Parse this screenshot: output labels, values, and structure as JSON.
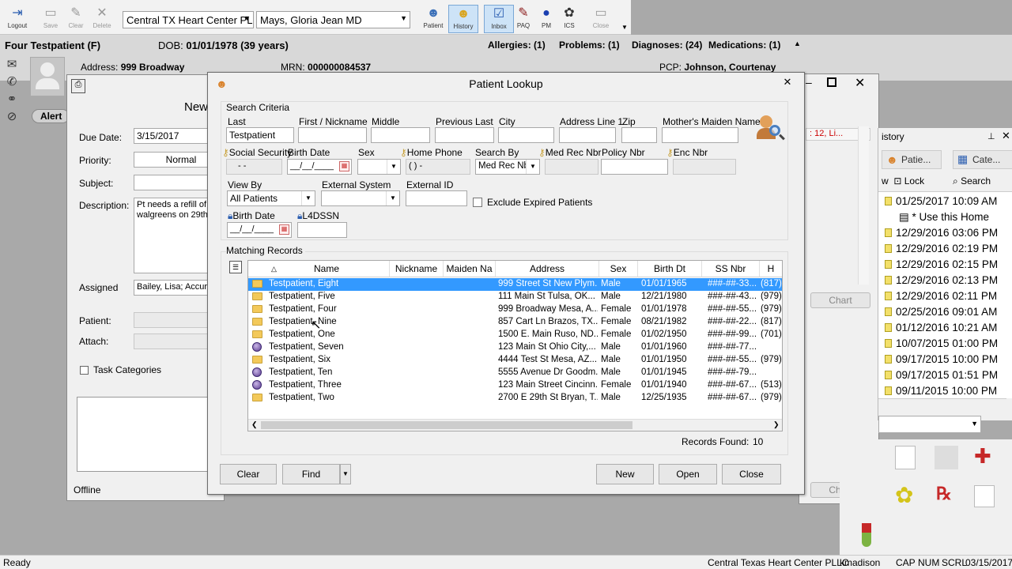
{
  "toolbar": {
    "logout": "Logout",
    "save": "Save",
    "clear": "Clear",
    "delete": "Delete",
    "location": "Central TX Heart Center PL",
    "provider": "Mays, Gloria Jean MD",
    "patient": "Patient",
    "history": "History",
    "inbox": "Inbox",
    "paq": "PAQ",
    "pm": "PM",
    "ics": "ICS",
    "close": "Close"
  },
  "banner": {
    "name": "Four Testpatient (F)",
    "dob_label": "DOB:",
    "dob": "01/01/1978 (39 years)",
    "allergies": "Allergies: (1)",
    "problems": "Problems: (1)",
    "diagnoses": "Diagnoses: (24)",
    "medications": "Medications: (1)",
    "address_label": "Address:",
    "address": "999 Broadway",
    "mrn_label": "MRN:",
    "mrn": "000000084537",
    "pcp_label": "PCP:",
    "pcp": "Johnson, Courtenay",
    "alert": "Alert"
  },
  "task": {
    "title": "New",
    "due_label": "Due Date:",
    "due": "3/15/2017",
    "priority_label": "Priority:",
    "priority": "Normal",
    "subject_label": "Subject:",
    "desc_label": "Description:",
    "desc": "Pt needs a refill of t walgreens on 29th",
    "assigned_label": "Assigned",
    "assigned": "Bailey, Lisa; Accurs",
    "patient_label": "Patient:",
    "attach_label": "Attach:",
    "task_categories": "Task Categories",
    "offline": "Offline"
  },
  "dialog": {
    "title": "Patient Lookup",
    "search_criteria": "Search Criteria",
    "last_label": "Last",
    "last": "Testpatient",
    "first_label": "First / Nickname",
    "middle_label": "Middle",
    "prev_last_label": "Previous Last",
    "city_label": "City",
    "addr1_label": "Address Line 1",
    "zip_label": "Zip",
    "maiden_label": "Mother's Maiden Name",
    "ssn_label": "Social Security",
    "ssn_mask": "- -",
    "bdate_label": "Birth Date",
    "bdate_mask": "__/__/____",
    "sex_label": "Sex",
    "home_phone_label": "Home Phone",
    "phone_mask": "(   )   -",
    "search_by_label": "Search By",
    "search_by": "Med Rec Nbr",
    "mrn_label": "Med Rec Nbr",
    "policy_label": "Policy Nbr",
    "enc_label": "Enc Nbr",
    "view_by_label": "View By",
    "view_by": "All Patients",
    "ext_system_label": "External System",
    "ext_id_label": "External ID",
    "exclude_expired": "Exclude Expired Patients",
    "bdate2_label": "Birth Date",
    "bdate2_mask": "__/__/____",
    "l4dssn_label": "L4DSSN",
    "matching_records": "Matching Records",
    "records_found_label": "Records Found:",
    "records_found": "10",
    "btn_clear": "Clear",
    "btn_find": "Find",
    "btn_new": "New",
    "btn_open": "Open",
    "btn_close": "Close"
  },
  "grid": {
    "columns": [
      "Name",
      "Nickname",
      "Maiden Na",
      "Address",
      "Sex",
      "Birth Dt",
      "SS Nbr",
      "H"
    ],
    "rows": [
      {
        "icon": "folder",
        "name": "Testpatient, Eight",
        "address": "999 Street St New Plym...",
        "sex": "Male",
        "dob": "01/01/1965",
        "ssn": "###-##-33...",
        "h": "(817)"
      },
      {
        "icon": "folder",
        "name": "Testpatient, Five",
        "address": "111 Main St Tulsa, OK...",
        "sex": "Male",
        "dob": "12/21/1980",
        "ssn": "###-##-43...",
        "h": "(979)"
      },
      {
        "icon": "folder",
        "name": "Testpatient, Four",
        "address": "999 Broadway Mesa, A...",
        "sex": "Female",
        "dob": "01/01/1978",
        "ssn": "###-##-55...",
        "h": "(979)"
      },
      {
        "icon": "folder",
        "name": "Testpatient, Nine",
        "address": "857 Cart Ln Brazos, TX...",
        "sex": "Female",
        "dob": "08/21/1982",
        "ssn": "###-##-22...",
        "h": "(817)"
      },
      {
        "icon": "folder",
        "name": "Testpatient, One",
        "address": "1500 E. Main Ruso, ND...",
        "sex": "Female",
        "dob": "01/02/1950",
        "ssn": "###-##-99...",
        "h": "(701)"
      },
      {
        "icon": "globe",
        "name": "Testpatient, Seven",
        "address": "123 Main St Ohio City,...",
        "sex": "Male",
        "dob": "01/01/1960",
        "ssn": "###-##-77...",
        "h": ""
      },
      {
        "icon": "folder",
        "name": "Testpatient, Six",
        "address": "4444 Test St Mesa, AZ...",
        "sex": "Male",
        "dob": "01/01/1950",
        "ssn": "###-##-55...",
        "h": "(979)"
      },
      {
        "icon": "globe",
        "name": "Testpatient, Ten",
        "address": "5555 Avenue Dr Goodm...",
        "sex": "Male",
        "dob": "01/01/1945",
        "ssn": "###-##-79...",
        "h": ""
      },
      {
        "icon": "globe",
        "name": "Testpatient, Three",
        "address": "123 Main Street Cincinn...",
        "sex": "Female",
        "dob": "01/01/1940",
        "ssn": "###-##-67...",
        "h": "(513)"
      },
      {
        "icon": "folder",
        "name": "Testpatient, Two",
        "address": "2700 E 29th St Bryan, T...",
        "sex": "Male",
        "dob": "12/25/1935",
        "ssn": "###-##-67...",
        "h": "(979)"
      }
    ]
  },
  "right": {
    "history_title": "istory",
    "tab_patient": "Patie...",
    "tab_cate": "Cate...",
    "lock": "Lock",
    "search": "Search",
    "items": [
      "01/25/2017 10:09 AM",
      "* Use this Home",
      "12/29/2016 03:06 PM",
      "12/29/2016 02:19 PM",
      "12/29/2016 02:15 PM",
      "12/29/2016 02:13 PM",
      "12/29/2016 02:11 PM",
      "02/25/2016 09:01 AM",
      "01/12/2016 10:21 AM",
      "10/07/2015 01:00 PM",
      "09/17/2015 10:00 PM",
      "09/17/2015 01:51 PM",
      "09/11/2015 10:00 PM"
    ],
    "red_text": ": 12, Li...",
    "chart": "Chart",
    "chart2": "Chart"
  },
  "status": {
    "ready": "Ready",
    "org": "Central Texas Heart Center PLLC",
    "user": "kmadison",
    "cap": "CAP",
    "num": "NUM",
    "scrl": "SCRL",
    "date": "03/15/2017"
  },
  "colors": {
    "selection": "#3399ff",
    "dialog_bg": "#f0f0f0",
    "app_bg": "#a9a9a9"
  }
}
